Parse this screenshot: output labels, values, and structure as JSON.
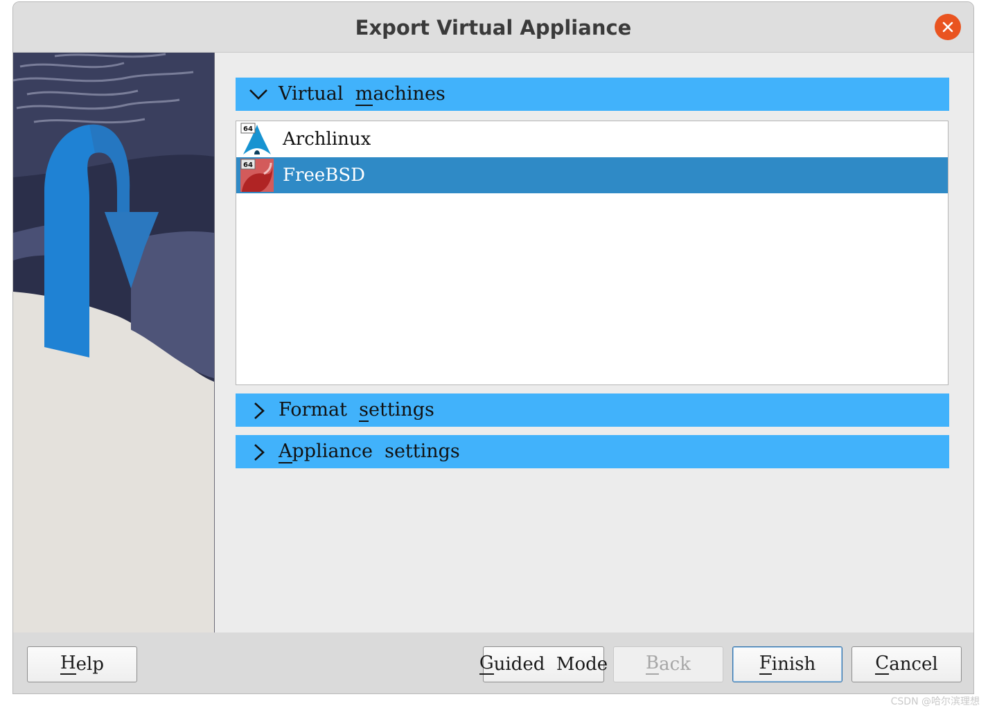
{
  "window": {
    "title": "Export Virtual Appliance"
  },
  "sections": {
    "virtual_machines": {
      "pre": "Virtual  ",
      "mnemonic": "m",
      "post": "achines",
      "expanded": true
    },
    "format_settings": {
      "pre": "Format  ",
      "mnemonic": "s",
      "post": "ettings",
      "expanded": false
    },
    "appliance_settings": {
      "pre": "",
      "mnemonic": "A",
      "post": "ppliance  settings",
      "expanded": false
    }
  },
  "vm_list": [
    {
      "name": "Archlinux",
      "badge": "64",
      "icon": "archlinux-icon",
      "selected": false
    },
    {
      "name": "FreeBSD",
      "badge": "64",
      "icon": "freebsd-icon",
      "selected": true
    }
  ],
  "buttons": {
    "help": {
      "mnemonic": "H",
      "rest": "elp"
    },
    "guided_mode": {
      "mnemonic": "G",
      "rest": "uided  Mode"
    },
    "back": {
      "mnemonic": "B",
      "rest": "ack",
      "disabled": true
    },
    "finish": {
      "mnemonic": "F",
      "rest": "inish",
      "default": true
    },
    "cancel": {
      "mnemonic": "C",
      "rest": "ancel"
    }
  },
  "watermark": "CSDN @哈尔滨理想",
  "colors": {
    "section_header": "#41b2fb",
    "selection": "#2f8ac6",
    "close_button": "#e95420"
  }
}
